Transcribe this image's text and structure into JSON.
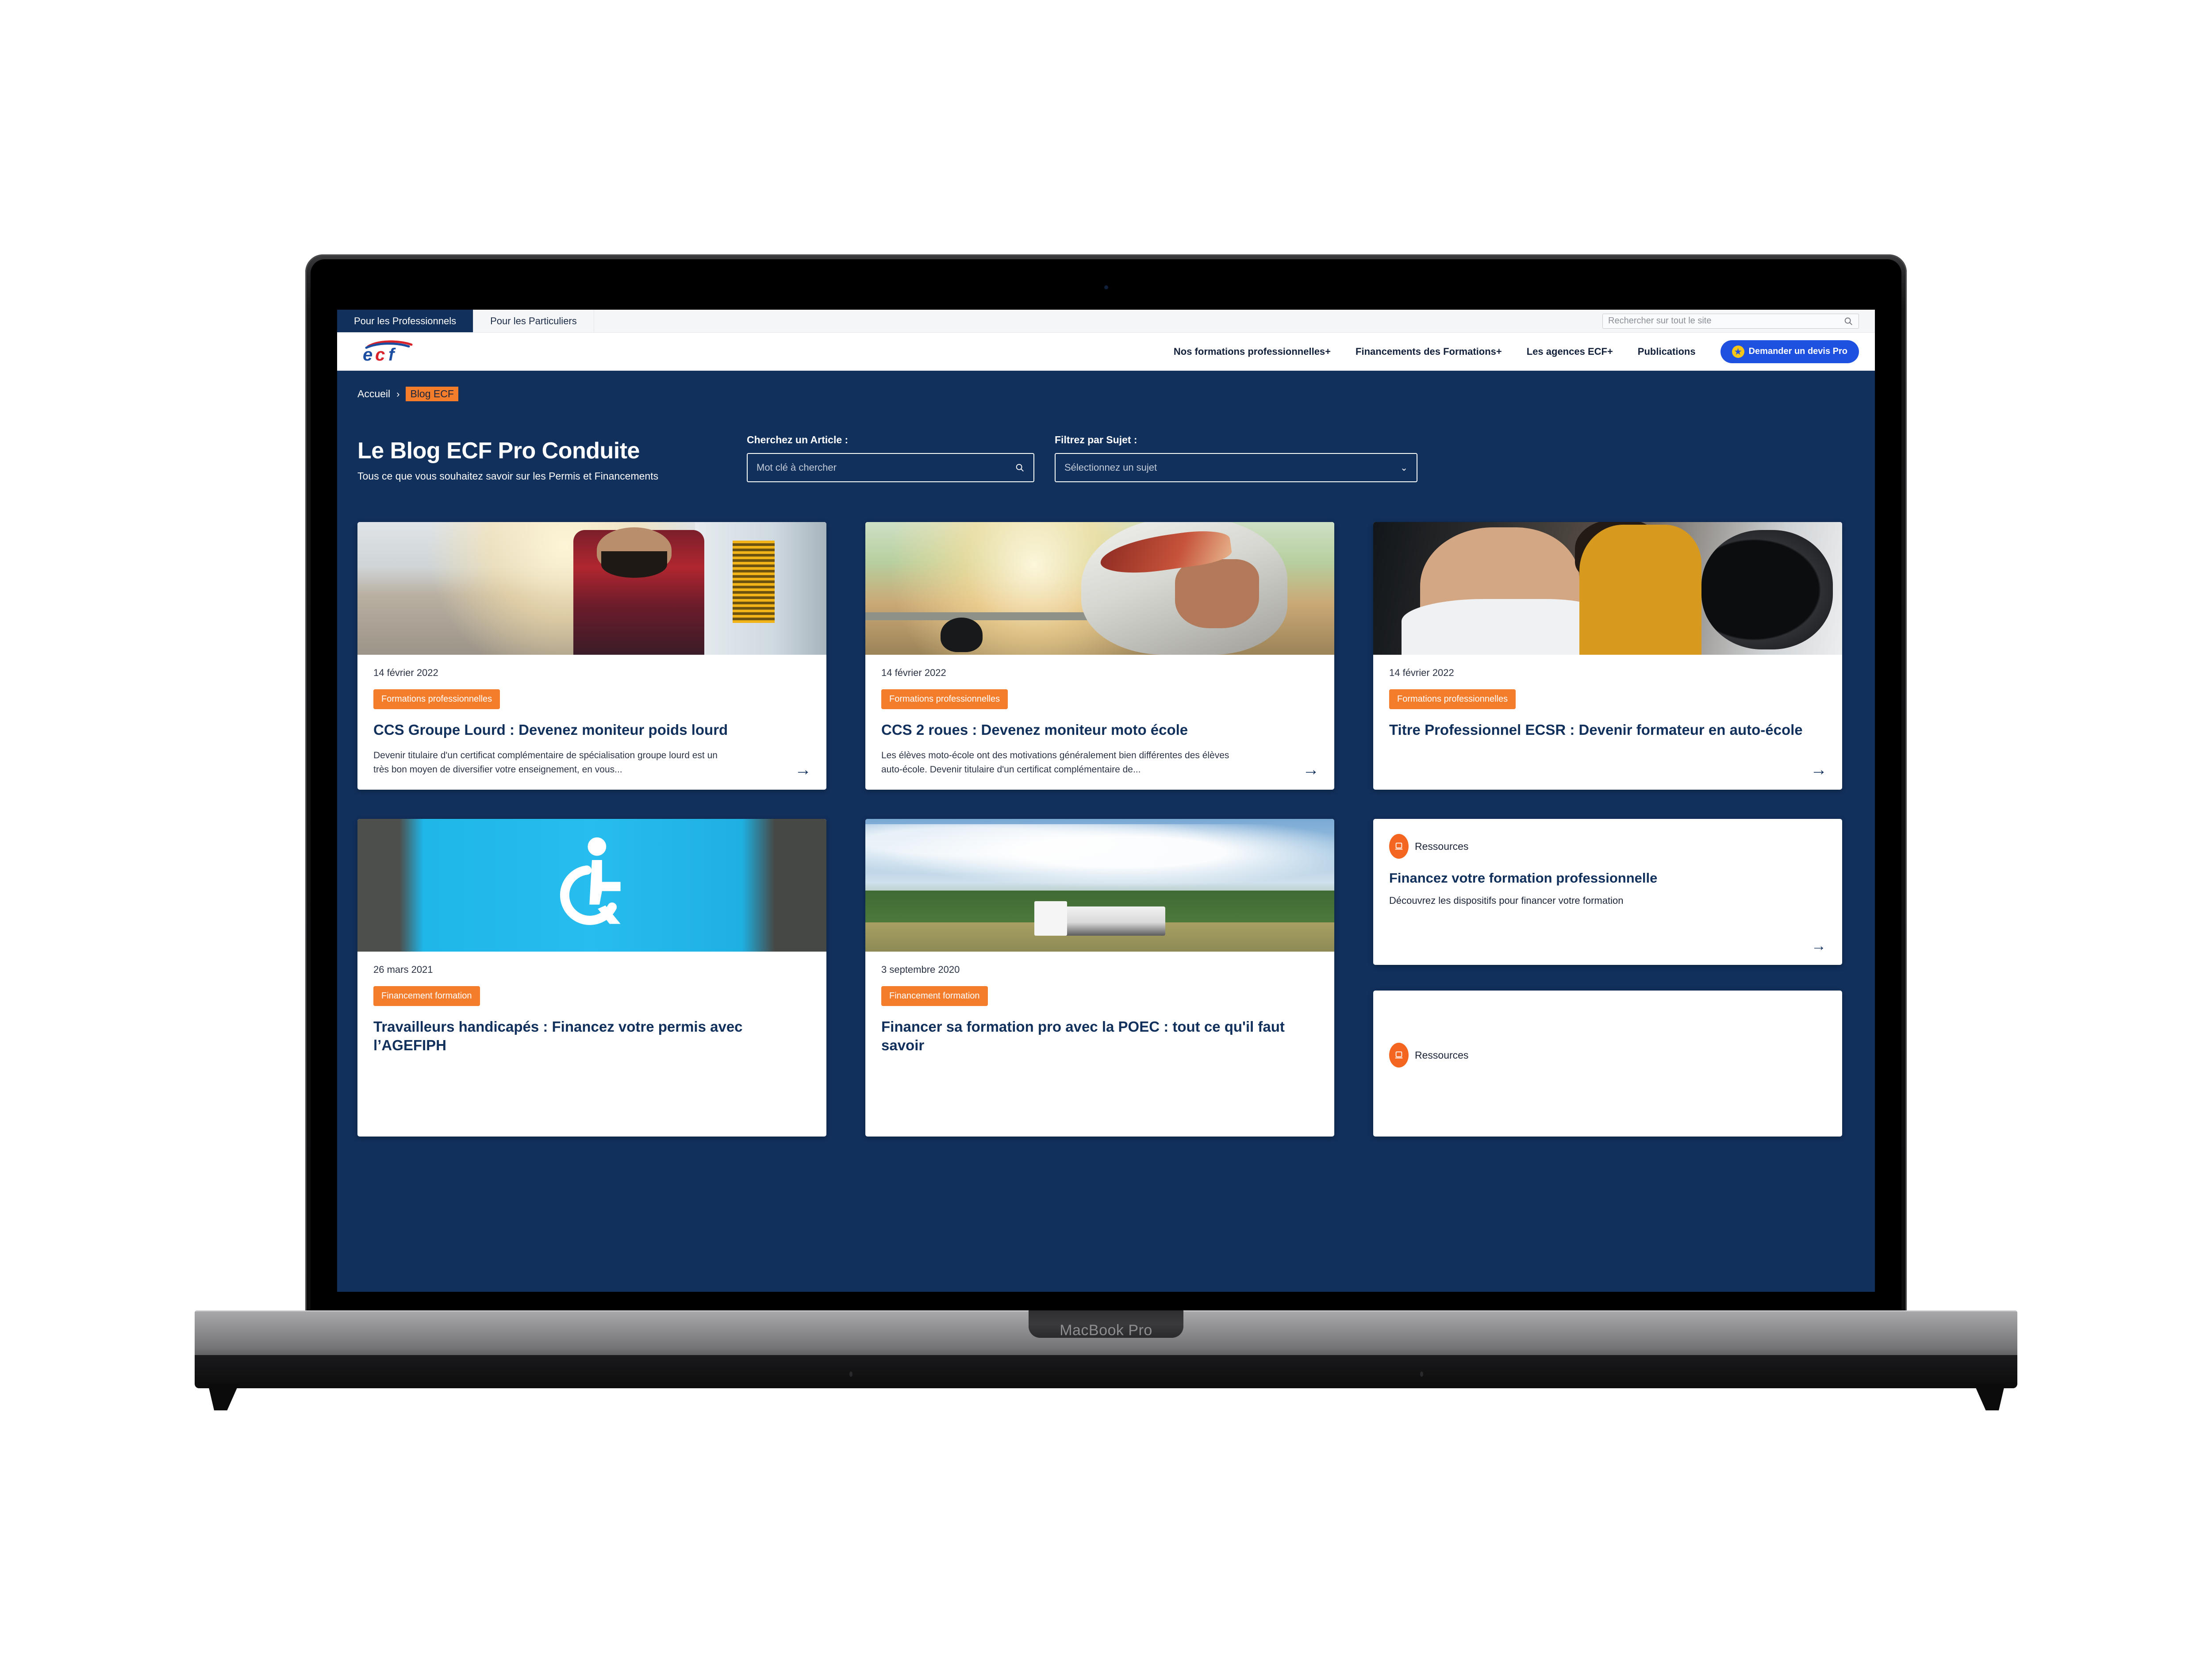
{
  "device": {
    "label": "MacBook Pro"
  },
  "utility_bar": {
    "tabs": [
      {
        "label": "Pour les Professionnels",
        "active": true
      },
      {
        "label": "Pour les Particuliers",
        "active": false
      }
    ],
    "search": {
      "placeholder": "Rechercher sur tout le site",
      "value": "",
      "icon": "search-icon"
    }
  },
  "main_nav": {
    "logo_text": "ecf",
    "links": [
      {
        "label": "Nos formations professionnelles",
        "expandable": "+"
      },
      {
        "label": "Financements des Formations",
        "expandable": "+"
      },
      {
        "label": "Les agences ECF",
        "expandable": "+"
      },
      {
        "label": "Publications",
        "expandable": ""
      }
    ],
    "cta": {
      "label": "Demander un devis Pro",
      "icon": "star-icon",
      "bg": "#1f51e0",
      "icon_bg": "#f5c518"
    }
  },
  "breadcrumb": {
    "home": "Accueil",
    "separator": "›",
    "current": "Blog ECF"
  },
  "hero": {
    "title": "Le Blog ECF Pro Conduite",
    "subtitle": "Tous ce que vous souhaitez savoir sur les Permis et Financements"
  },
  "filters": {
    "search": {
      "label": "Cherchez un Article :",
      "placeholder": "Mot clé à chercher",
      "value": "",
      "icon": "search-icon"
    },
    "subject": {
      "label": "Filtrez par Sujet :",
      "selected": "Sélectionnez un sujet",
      "icon": "chevron-down-icon"
    }
  },
  "theme": {
    "navy": "#12305c",
    "orange": "#f47d2c",
    "blue_cta": "#1f51e0",
    "white": "#ffffff"
  },
  "articles": [
    {
      "date": "14 février 2022",
      "tag": "Formations professionnelles",
      "title": "CCS Groupe Lourd : Devenez moniteur poids lourd",
      "excerpt": "Devenir titulaire d'un certificat complémentaire de spécialisation groupe lourd est un très bon moyen de diversifier votre enseignement, en vous...",
      "image": "truck-driver-photo",
      "arrow": "→"
    },
    {
      "date": "14 février 2022",
      "tag": "Formations professionnelles",
      "title": "CCS 2 roues : Devenez moniteur moto école",
      "excerpt": "Les élèves moto-école ont des motivations généralement bien différentes des élèves auto-école. Devenir titulaire d'un certificat complémentaire de...",
      "image": "motorcyclist-photo",
      "arrow": "→"
    },
    {
      "date": "14 février 2022",
      "tag": "Formations professionnelles",
      "title": "Titre Professionnel ECSR : Devenir formateur en auto-école",
      "excerpt": "",
      "image": "driving-lesson-photo",
      "arrow": "→"
    },
    {
      "date": "26 mars 2021",
      "tag": "Financement formation",
      "title": "Travailleurs handicapés : Financez votre permis avec l’AGEFIPH",
      "excerpt": "",
      "image": "wheelchair-parking-photo",
      "arrow": "→"
    },
    {
      "date": "3 septembre 2020",
      "tag": "Financement formation",
      "title": "Financer sa formation pro avec la POEC : tout ce qu'il faut savoir",
      "excerpt": "",
      "image": "tanker-truck-photo",
      "arrow": "→"
    }
  ],
  "resources": [
    {
      "label": "Ressources",
      "icon": "laptop-icon",
      "title": "Financez votre formation professionnelle",
      "subtitle": "Découvrez les dispositifs pour financer votre formation",
      "arrow": "→"
    },
    {
      "label": "Ressources",
      "icon": "laptop-icon",
      "title": "",
      "subtitle": "",
      "arrow": "→"
    }
  ]
}
